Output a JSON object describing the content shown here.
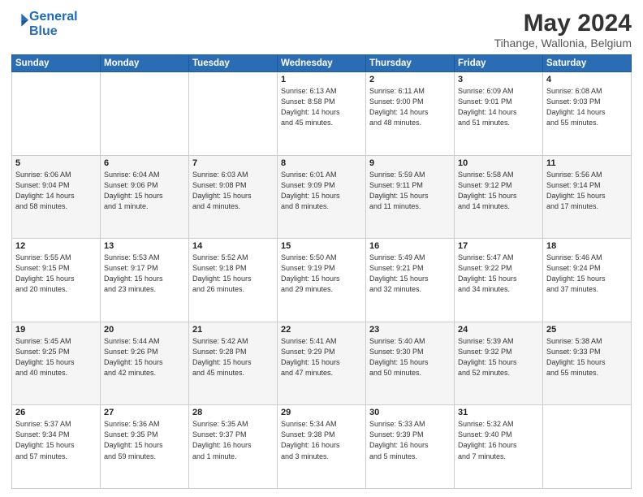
{
  "header": {
    "logo_line1": "General",
    "logo_line2": "Blue",
    "main_title": "May 2024",
    "subtitle": "Tihange, Wallonia, Belgium"
  },
  "days_of_week": [
    "Sunday",
    "Monday",
    "Tuesday",
    "Wednesday",
    "Thursday",
    "Friday",
    "Saturday"
  ],
  "weeks": [
    [
      {
        "day": "",
        "info": ""
      },
      {
        "day": "",
        "info": ""
      },
      {
        "day": "",
        "info": ""
      },
      {
        "day": "1",
        "info": "Sunrise: 6:13 AM\nSunset: 8:58 PM\nDaylight: 14 hours\nand 45 minutes."
      },
      {
        "day": "2",
        "info": "Sunrise: 6:11 AM\nSunset: 9:00 PM\nDaylight: 14 hours\nand 48 minutes."
      },
      {
        "day": "3",
        "info": "Sunrise: 6:09 AM\nSunset: 9:01 PM\nDaylight: 14 hours\nand 51 minutes."
      },
      {
        "day": "4",
        "info": "Sunrise: 6:08 AM\nSunset: 9:03 PM\nDaylight: 14 hours\nand 55 minutes."
      }
    ],
    [
      {
        "day": "5",
        "info": "Sunrise: 6:06 AM\nSunset: 9:04 PM\nDaylight: 14 hours\nand 58 minutes."
      },
      {
        "day": "6",
        "info": "Sunrise: 6:04 AM\nSunset: 9:06 PM\nDaylight: 15 hours\nand 1 minute."
      },
      {
        "day": "7",
        "info": "Sunrise: 6:03 AM\nSunset: 9:08 PM\nDaylight: 15 hours\nand 4 minutes."
      },
      {
        "day": "8",
        "info": "Sunrise: 6:01 AM\nSunset: 9:09 PM\nDaylight: 15 hours\nand 8 minutes."
      },
      {
        "day": "9",
        "info": "Sunrise: 5:59 AM\nSunset: 9:11 PM\nDaylight: 15 hours\nand 11 minutes."
      },
      {
        "day": "10",
        "info": "Sunrise: 5:58 AM\nSunset: 9:12 PM\nDaylight: 15 hours\nand 14 minutes."
      },
      {
        "day": "11",
        "info": "Sunrise: 5:56 AM\nSunset: 9:14 PM\nDaylight: 15 hours\nand 17 minutes."
      }
    ],
    [
      {
        "day": "12",
        "info": "Sunrise: 5:55 AM\nSunset: 9:15 PM\nDaylight: 15 hours\nand 20 minutes."
      },
      {
        "day": "13",
        "info": "Sunrise: 5:53 AM\nSunset: 9:17 PM\nDaylight: 15 hours\nand 23 minutes."
      },
      {
        "day": "14",
        "info": "Sunrise: 5:52 AM\nSunset: 9:18 PM\nDaylight: 15 hours\nand 26 minutes."
      },
      {
        "day": "15",
        "info": "Sunrise: 5:50 AM\nSunset: 9:19 PM\nDaylight: 15 hours\nand 29 minutes."
      },
      {
        "day": "16",
        "info": "Sunrise: 5:49 AM\nSunset: 9:21 PM\nDaylight: 15 hours\nand 32 minutes."
      },
      {
        "day": "17",
        "info": "Sunrise: 5:47 AM\nSunset: 9:22 PM\nDaylight: 15 hours\nand 34 minutes."
      },
      {
        "day": "18",
        "info": "Sunrise: 5:46 AM\nSunset: 9:24 PM\nDaylight: 15 hours\nand 37 minutes."
      }
    ],
    [
      {
        "day": "19",
        "info": "Sunrise: 5:45 AM\nSunset: 9:25 PM\nDaylight: 15 hours\nand 40 minutes."
      },
      {
        "day": "20",
        "info": "Sunrise: 5:44 AM\nSunset: 9:26 PM\nDaylight: 15 hours\nand 42 minutes."
      },
      {
        "day": "21",
        "info": "Sunrise: 5:42 AM\nSunset: 9:28 PM\nDaylight: 15 hours\nand 45 minutes."
      },
      {
        "day": "22",
        "info": "Sunrise: 5:41 AM\nSunset: 9:29 PM\nDaylight: 15 hours\nand 47 minutes."
      },
      {
        "day": "23",
        "info": "Sunrise: 5:40 AM\nSunset: 9:30 PM\nDaylight: 15 hours\nand 50 minutes."
      },
      {
        "day": "24",
        "info": "Sunrise: 5:39 AM\nSunset: 9:32 PM\nDaylight: 15 hours\nand 52 minutes."
      },
      {
        "day": "25",
        "info": "Sunrise: 5:38 AM\nSunset: 9:33 PM\nDaylight: 15 hours\nand 55 minutes."
      }
    ],
    [
      {
        "day": "26",
        "info": "Sunrise: 5:37 AM\nSunset: 9:34 PM\nDaylight: 15 hours\nand 57 minutes."
      },
      {
        "day": "27",
        "info": "Sunrise: 5:36 AM\nSunset: 9:35 PM\nDaylight: 15 hours\nand 59 minutes."
      },
      {
        "day": "28",
        "info": "Sunrise: 5:35 AM\nSunset: 9:37 PM\nDaylight: 16 hours\nand 1 minute."
      },
      {
        "day": "29",
        "info": "Sunrise: 5:34 AM\nSunset: 9:38 PM\nDaylight: 16 hours\nand 3 minutes."
      },
      {
        "day": "30",
        "info": "Sunrise: 5:33 AM\nSunset: 9:39 PM\nDaylight: 16 hours\nand 5 minutes."
      },
      {
        "day": "31",
        "info": "Sunrise: 5:32 AM\nSunset: 9:40 PM\nDaylight: 16 hours\nand 7 minutes."
      },
      {
        "day": "",
        "info": ""
      }
    ]
  ]
}
